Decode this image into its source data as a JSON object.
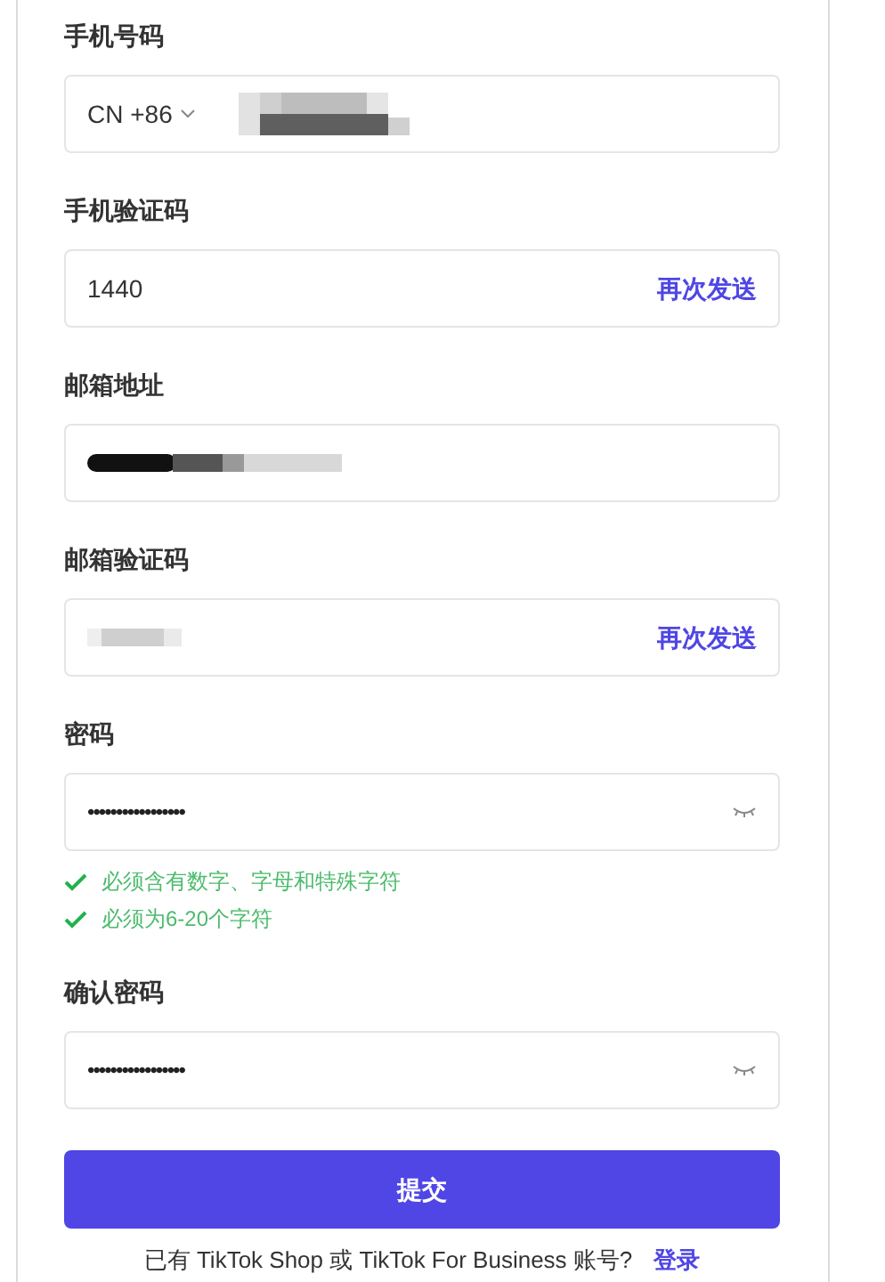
{
  "fields": [
    {
      "label": "手机号码",
      "kind": "phone",
      "country_code": "CN +86",
      "redacted": true
    },
    {
      "label": "手机验证码",
      "kind": "code",
      "value": "1440",
      "action": "再次发送"
    },
    {
      "label": "邮箱地址",
      "kind": "text",
      "redacted": true
    },
    {
      "label": "邮箱验证码",
      "kind": "code",
      "redacted": true,
      "action": "再次发送"
    },
    {
      "label": "密码",
      "kind": "password",
      "value": "•••••••••••••••••",
      "rules": [
        {
          "text": "必须含有数字、字母和特殊字符",
          "met": true
        },
        {
          "text": "必须为6-20个字符",
          "met": true
        }
      ]
    },
    {
      "label": "确认密码",
      "kind": "password",
      "value": "•••••••••••••••••"
    }
  ],
  "submit": "提交",
  "footer": {
    "text": "已有 TikTok Shop 或 TikTok For Business 账号?",
    "link": "登录"
  }
}
